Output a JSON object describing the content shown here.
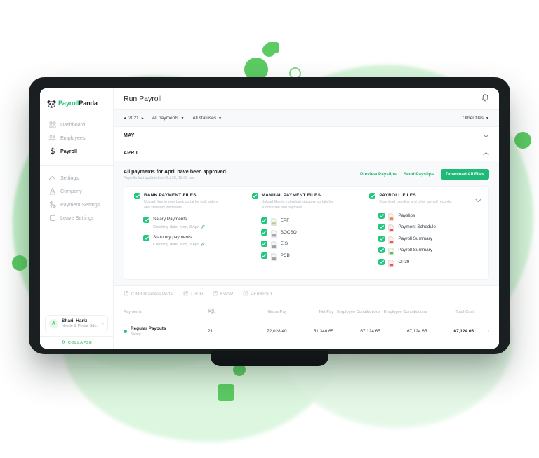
{
  "brand": {
    "name_green": "Payroll",
    "name_dark": "Panda",
    "accent_green": "#1fb978",
    "bright_green": "#5ccb63"
  },
  "sidebar": {
    "nav_primary": [
      {
        "label": "Dashboard",
        "icon": "dashboard-grid-icon",
        "active": false
      },
      {
        "label": "Employees",
        "icon": "employees-people-icon",
        "active": false
      },
      {
        "label": "Payroll",
        "icon": "payroll-dollar-icon",
        "active": true
      }
    ],
    "nav_secondary": [
      {
        "label": "Settings",
        "icon": "settings-chevron-icon"
      },
      {
        "label": "Company",
        "icon": "company-building-icon"
      },
      {
        "label": "Payment Settings",
        "icon": "payment-settings-icon"
      },
      {
        "label": "Leave Settings",
        "icon": "leave-settings-icon"
      }
    ],
    "user": {
      "initial": "A",
      "name": "Sharil Hariz",
      "org": "Nestle & Portar Sdn..",
      "chevron": "›"
    },
    "collapse_label": "COLLAPSE"
  },
  "header": {
    "title": "Run Payroll",
    "bell_icon": "notification-bell-icon"
  },
  "filters": {
    "year": "2021",
    "prev_icon": "◂",
    "next_icon": "▸",
    "payments_filter": "All payments",
    "statuses_filter": "All statuses",
    "other_files": "Other files"
  },
  "months": [
    {
      "label": "MAY",
      "expanded": false
    },
    {
      "label": "APRIL",
      "expanded": true
    }
  ],
  "april": {
    "banner_title": "All payments for April have been approved.",
    "banner_sub": "Payrolls last updated on Oct 20, 12:08 pm",
    "actions": {
      "preview": "Preview Payslips",
      "send": "Send Payslips",
      "download": "Download All Files"
    },
    "panels": [
      {
        "title": "BANK PAYMENT FILES",
        "desc": "Upload files to your bank portal for bulk salary and statutory payments.",
        "checked": true,
        "sub_items": [
          {
            "label": "Salary Payments",
            "meta": "Crediting date: Mon, 3 Apr",
            "checked": true,
            "edit_icon": "pencil-edit-icon"
          },
          {
            "label": "Statutory payments",
            "meta": "Crediting date: Mon, 3 Apr",
            "checked": true,
            "edit_icon": "pencil-edit-icon"
          }
        ],
        "files": []
      },
      {
        "title": "MANUAL PAYMENT FILES",
        "desc": "Upload files to individual statutory portals for submission and payment.",
        "checked": true,
        "sub_items": [],
        "files": [
          {
            "label": "EPF",
            "type": "txt-file-icon",
            "checked": true
          },
          {
            "label": "SOCSO",
            "type": "txt-file-icon",
            "checked": true
          },
          {
            "label": "EIS",
            "type": "txt-file-icon",
            "checked": true
          },
          {
            "label": "PCB",
            "type": "txt-file-icon",
            "checked": true
          }
        ]
      },
      {
        "title": "PAYROLL FILES",
        "desc": "Download payslips and other payroll records.",
        "checked": true,
        "collapse_icon": "chevron-down-icon",
        "sub_items": [],
        "files": [
          {
            "label": "Payslips",
            "type": "pdf-file-icon",
            "checked": true
          },
          {
            "label": "Payment Schedule",
            "type": "pdf-file-icon",
            "checked": true
          },
          {
            "label": "Payroll Summary",
            "type": "pdf-file-icon",
            "checked": true
          },
          {
            "label": "Payroll Summary",
            "type": "xls-file-icon",
            "checked": true
          },
          {
            "label": "CP39",
            "type": "pdf-file-icon",
            "checked": true
          }
        ]
      }
    ],
    "portals": [
      {
        "label": "CIMB Business Portal",
        "icon": "external-link-icon"
      },
      {
        "label": "LHDN",
        "icon": "external-link-icon"
      },
      {
        "label": "KWSP",
        "icon": "external-link-icon"
      },
      {
        "label": "PERKESO",
        "icon": "external-link-icon"
      }
    ]
  },
  "table": {
    "headers": {
      "payments": "Payments",
      "headcount_icon": "employees-count-icon",
      "gross_pay": "Gross Pay",
      "net_pay": "Net Pay",
      "employee_contributions_1": "Employee Contributions",
      "employee_contributions_2": "Employee Contributions",
      "total_cost": "Total Cost"
    },
    "rows": [
      {
        "status_dot": "#2cc47f",
        "name": "Regular Payouts",
        "sub": "Salary",
        "headcount": "21",
        "gross_pay": "72,028.40",
        "net_pay": "51,340.65",
        "employee_contributions_1": "67,124.65",
        "employee_contributions_2": "67,124.65",
        "total_cost": "67,124.65",
        "chevron": "›"
      }
    ]
  }
}
